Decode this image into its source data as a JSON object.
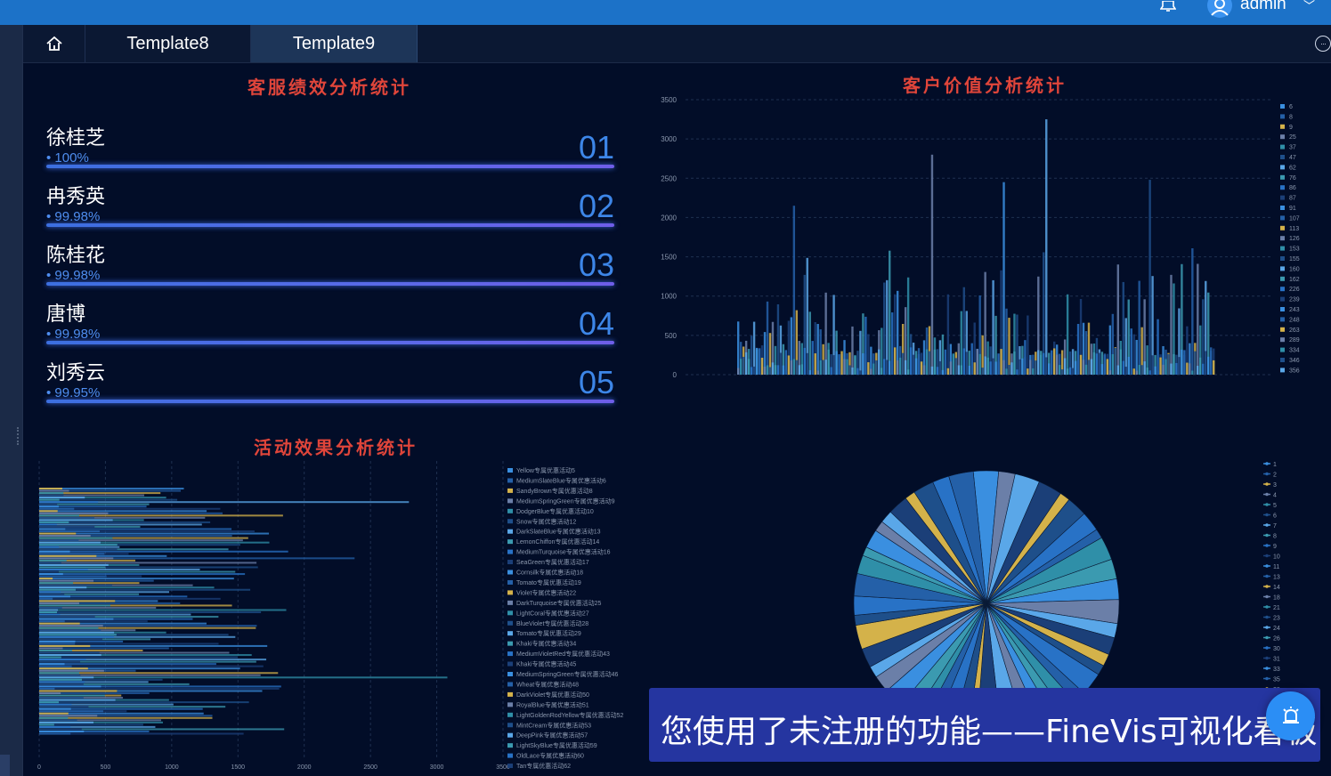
{
  "header": {
    "user_name": "admin",
    "bell_icon": "bell-icon",
    "user_icon": "user-icon",
    "caret_icon": "chevron-down-icon"
  },
  "tabs": [
    {
      "label": "",
      "icon": "home-icon"
    },
    {
      "label": "Template8"
    },
    {
      "label": "Template9",
      "active": true
    }
  ],
  "panels": {
    "ranking_title": "客服绩效分析统计",
    "value_title": "客户价值分析统计",
    "activity_title": "活动效果分析统计"
  },
  "ranking": [
    {
      "name": "徐桂芝",
      "pct": "• 100%",
      "rank": "01"
    },
    {
      "name": "冉秀英",
      "pct": "• 99.98%",
      "rank": "02"
    },
    {
      "name": "陈桂花",
      "pct": "• 99.98%",
      "rank": "03"
    },
    {
      "name": "唐博",
      "pct": "• 99.98%",
      "rank": "04"
    },
    {
      "name": "刘秀云",
      "pct": "• 99.95%",
      "rank": "05"
    }
  ],
  "chart_data": [
    {
      "type": "bar",
      "title": "客户价值分析统计",
      "ylim": [
        0,
        3500
      ],
      "yticks": [
        "3500",
        "3000",
        "2500",
        "2000",
        "1500",
        "1000",
        "500",
        "0"
      ],
      "grid": true,
      "legend_position": "right",
      "legend": [
        "6",
        "8",
        "9",
        "25",
        "37",
        "47",
        "62",
        "76",
        "86",
        "87",
        "91",
        "107",
        "113",
        "126",
        "153",
        "155",
        "160",
        "162",
        "226",
        "239",
        "243",
        "248",
        "263",
        "289",
        "334",
        "346",
        "356"
      ],
      "peaks": [
        {
          "x_index": 21,
          "value": 2150
        },
        {
          "x_index": 73,
          "value": 2800
        },
        {
          "x_index": 100,
          "value": 2450
        },
        {
          "x_index": 116,
          "value": 3250
        },
        {
          "x_index": 155,
          "value": 2480
        }
      ]
    },
    {
      "type": "bar",
      "orientation": "horizontal",
      "title": "活动效果分析统计",
      "xlim": [
        0,
        3500
      ],
      "xticks": [
        "0",
        "500",
        "1000",
        "1500",
        "2000",
        "2500",
        "3000",
        "3500"
      ],
      "grid": true,
      "legend_position": "right",
      "legend": [
        "Yellow专属优惠活动5",
        "MediumSlateBlue专属优惠活动6",
        "SandyBrown专属优惠活动8",
        "MediumSpringGreen专属优惠活动9",
        "DodgerBlue专属优惠活动10",
        "Snow专属优惠活动12",
        "DarkSlateBlue专属优惠活动13",
        "LemonChiffon专属优惠活动14",
        "MediumTurquoise专属优惠活动16",
        "SeaGreen专属优惠活动17",
        "Cornsilk专属优惠活动18",
        "Tomato专属优惠活动19",
        "Violet专属优惠活动22",
        "DarkTurquoise专属优惠活动25",
        "LightCoral专属优惠活动27",
        "BlueViolet专属优惠活动28",
        "Tomato专属优惠活动29",
        "Khaki专属优惠活动34",
        "MediumVioletRed专属优惠活动43",
        "Khaki专属优惠活动45",
        "MediumSpringGreen专属优惠活动46",
        "Wheat专属优惠活动48",
        "DarkViolet专属优惠活动50",
        "RoyalBlue专属优惠活动51",
        "LightGoldenRodYellow专属优惠活动52",
        "MintCream专属优惠活动53",
        "DeepPink专属优惠活动57",
        "LightSkyBlue专属优惠活动59",
        "OldLace专属优惠活动60",
        "Tan专属优惠活动62"
      ],
      "peaks": [
        {
          "y_index": 6,
          "value": 2790
        },
        {
          "y_index": 31,
          "value": 2380
        },
        {
          "y_index": 84,
          "value": 3080
        }
      ]
    },
    {
      "type": "pie",
      "legend_position": "right",
      "legend": [
        "1",
        "2",
        "3",
        "4",
        "5",
        "6",
        "7",
        "8",
        "9",
        "10",
        "11",
        "13",
        "14",
        "18",
        "21",
        "23",
        "24",
        "26",
        "30",
        "31",
        "33",
        "35",
        "38"
      ]
    }
  ],
  "palette": [
    "#3a8fe0",
    "#2460a8",
    "#d4b24a",
    "#6b7fa8",
    "#2f8fa8",
    "#1e4f8a",
    "#5aa7e8",
    "#3b9ab0",
    "#2872c6",
    "#1b3f78"
  ],
  "banner": {
    "text": "您使用了未注册的功能——FineVis可视化看板",
    "fab_icon": "alarm-icon"
  }
}
